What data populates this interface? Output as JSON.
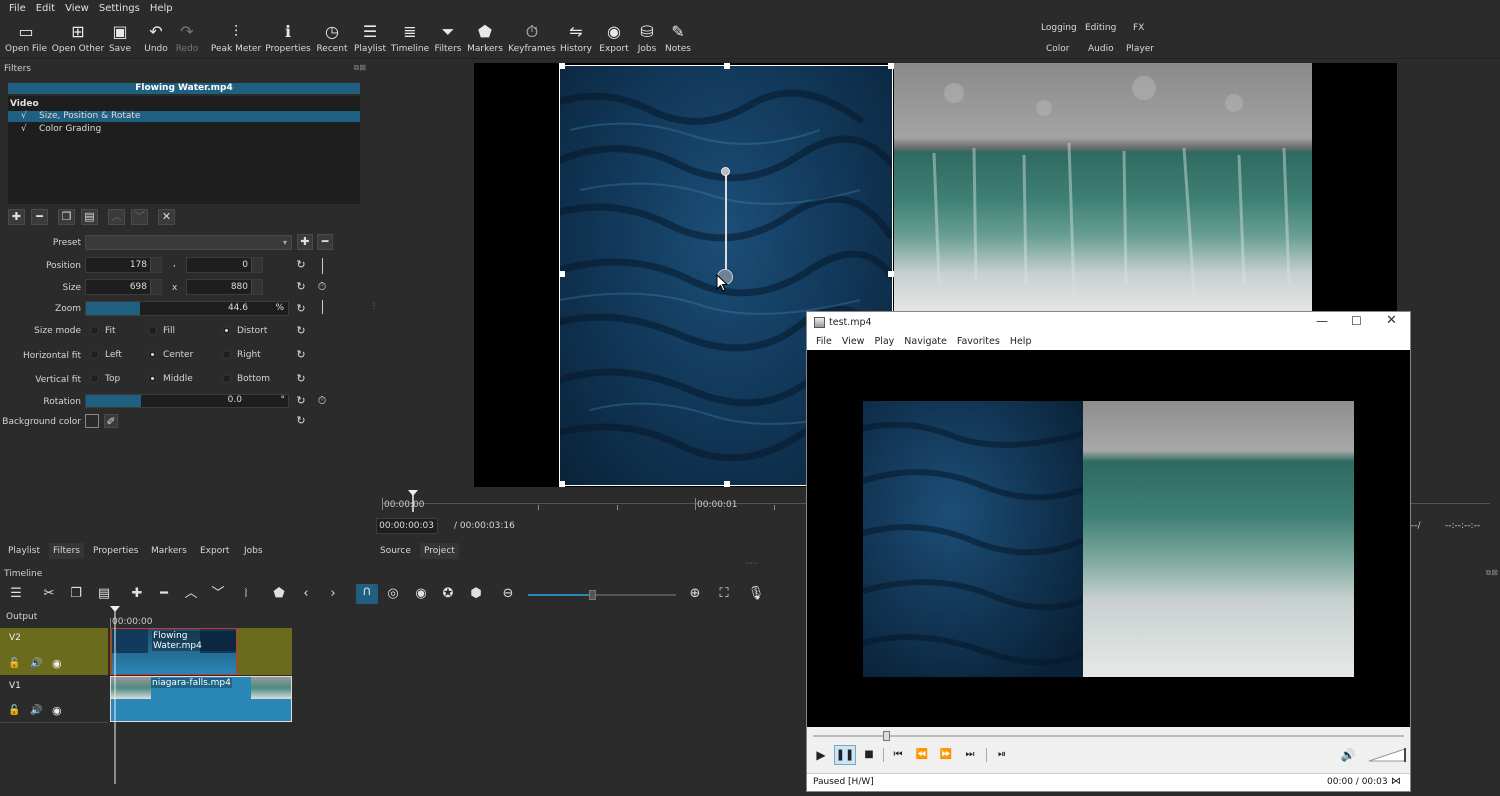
{
  "menubar": [
    "File",
    "Edit",
    "View",
    "Settings",
    "Help"
  ],
  "toolbar": [
    {
      "label": "Open File",
      "icon": "open-folder-icon",
      "glyph": "▭"
    },
    {
      "label": "Open Other",
      "icon": "open-other-icon",
      "glyph": "⊞"
    },
    {
      "label": "Save",
      "icon": "save-icon",
      "glyph": "▣"
    },
    {
      "label": "Undo",
      "icon": "undo-icon",
      "glyph": "↶"
    },
    {
      "label": "Redo",
      "icon": "redo-icon",
      "glyph": "↷"
    },
    {
      "label": "Peak Meter",
      "icon": "peak-meter-icon",
      "glyph": "⫶"
    },
    {
      "label": "Properties",
      "icon": "info-icon",
      "glyph": "ℹ"
    },
    {
      "label": "Recent",
      "icon": "clock-icon",
      "glyph": "◷"
    },
    {
      "label": "Playlist",
      "icon": "list-icon",
      "glyph": "☰"
    },
    {
      "label": "Timeline",
      "icon": "timeline-icon",
      "glyph": "≣"
    },
    {
      "label": "Filters",
      "icon": "funnel-icon",
      "glyph": "⏷"
    },
    {
      "label": "Markers",
      "icon": "marker-icon",
      "glyph": "⬟"
    },
    {
      "label": "Keyframes",
      "icon": "stopwatch-icon",
      "glyph": "⏱"
    },
    {
      "label": "History",
      "icon": "history-icon",
      "glyph": "⇋"
    },
    {
      "label": "Export",
      "icon": "export-icon",
      "glyph": "◉"
    },
    {
      "label": "Jobs",
      "icon": "database-icon",
      "glyph": "⛁"
    },
    {
      "label": "Notes",
      "icon": "notes-icon",
      "glyph": "✎"
    }
  ],
  "workspaces": {
    "row1": [
      "Logging",
      "Editing",
      "FX"
    ],
    "row2": [
      "Color",
      "Audio",
      "Player"
    ]
  },
  "filters_panel": {
    "title": "Filters",
    "clip_name": "Flowing Water.mp4",
    "section": "Video",
    "items": [
      {
        "check": "√",
        "name": "Size, Position & Rotate"
      },
      {
        "check": "√",
        "name": "Color Grading"
      }
    ],
    "preset_label": "Preset",
    "position_label": "Position",
    "position_x": "178",
    "position_sep": ",",
    "position_y": "0",
    "size_label": "Size",
    "size_w": "698",
    "size_sep": "x",
    "size_h": "880",
    "zoom_label": "Zoom",
    "zoom_value": "44.6",
    "zoom_unit": "%",
    "zoom_fraction": 0.446,
    "size_mode_label": "Size mode",
    "size_modes": [
      "Fit",
      "Fill",
      "Distort"
    ],
    "hfit_label": "Horizontal fit",
    "hfit": [
      "Left",
      "Center",
      "Right"
    ],
    "vfit_label": "Vertical fit",
    "vfit": [
      "Top",
      "Middle",
      "Bottom"
    ],
    "rotation_label": "Rotation",
    "rotation_value": "0.0",
    "rotation_unit": "°",
    "bg_label": "Background color"
  },
  "ruler": {
    "t0": "00:00:00",
    "t1": "00:00:01"
  },
  "timecode": {
    "current": "00:00:00:03",
    "total": "/ 00:00:03:16",
    "right1": "--/",
    "right2": "--:--:--:--"
  },
  "left_tabs": [
    "Playlist",
    "Filters",
    "Properties",
    "Markers",
    "Export",
    "Jobs"
  ],
  "preview_tabs": [
    "Source",
    "Project"
  ],
  "timeline": {
    "title": "Timeline",
    "output": "Output",
    "ruler": "00:00:00",
    "tracks": [
      {
        "name": "V2",
        "clip": "Flowing Water.mp4"
      },
      {
        "name": "V1",
        "clip": "niagara-falls.mp4"
      }
    ]
  },
  "player": {
    "title": "test.mp4",
    "menu": [
      "File",
      "View",
      "Play",
      "Navigate",
      "Favorites",
      "Help"
    ],
    "status": "Paused [H/W]",
    "time": "00:00 / 00:03"
  },
  "colors": {
    "accent": "#1f5f7f",
    "clip_v2": "#6b6b1e",
    "clip_v1": "#2a86b5",
    "bg": "#2b2b2b"
  }
}
